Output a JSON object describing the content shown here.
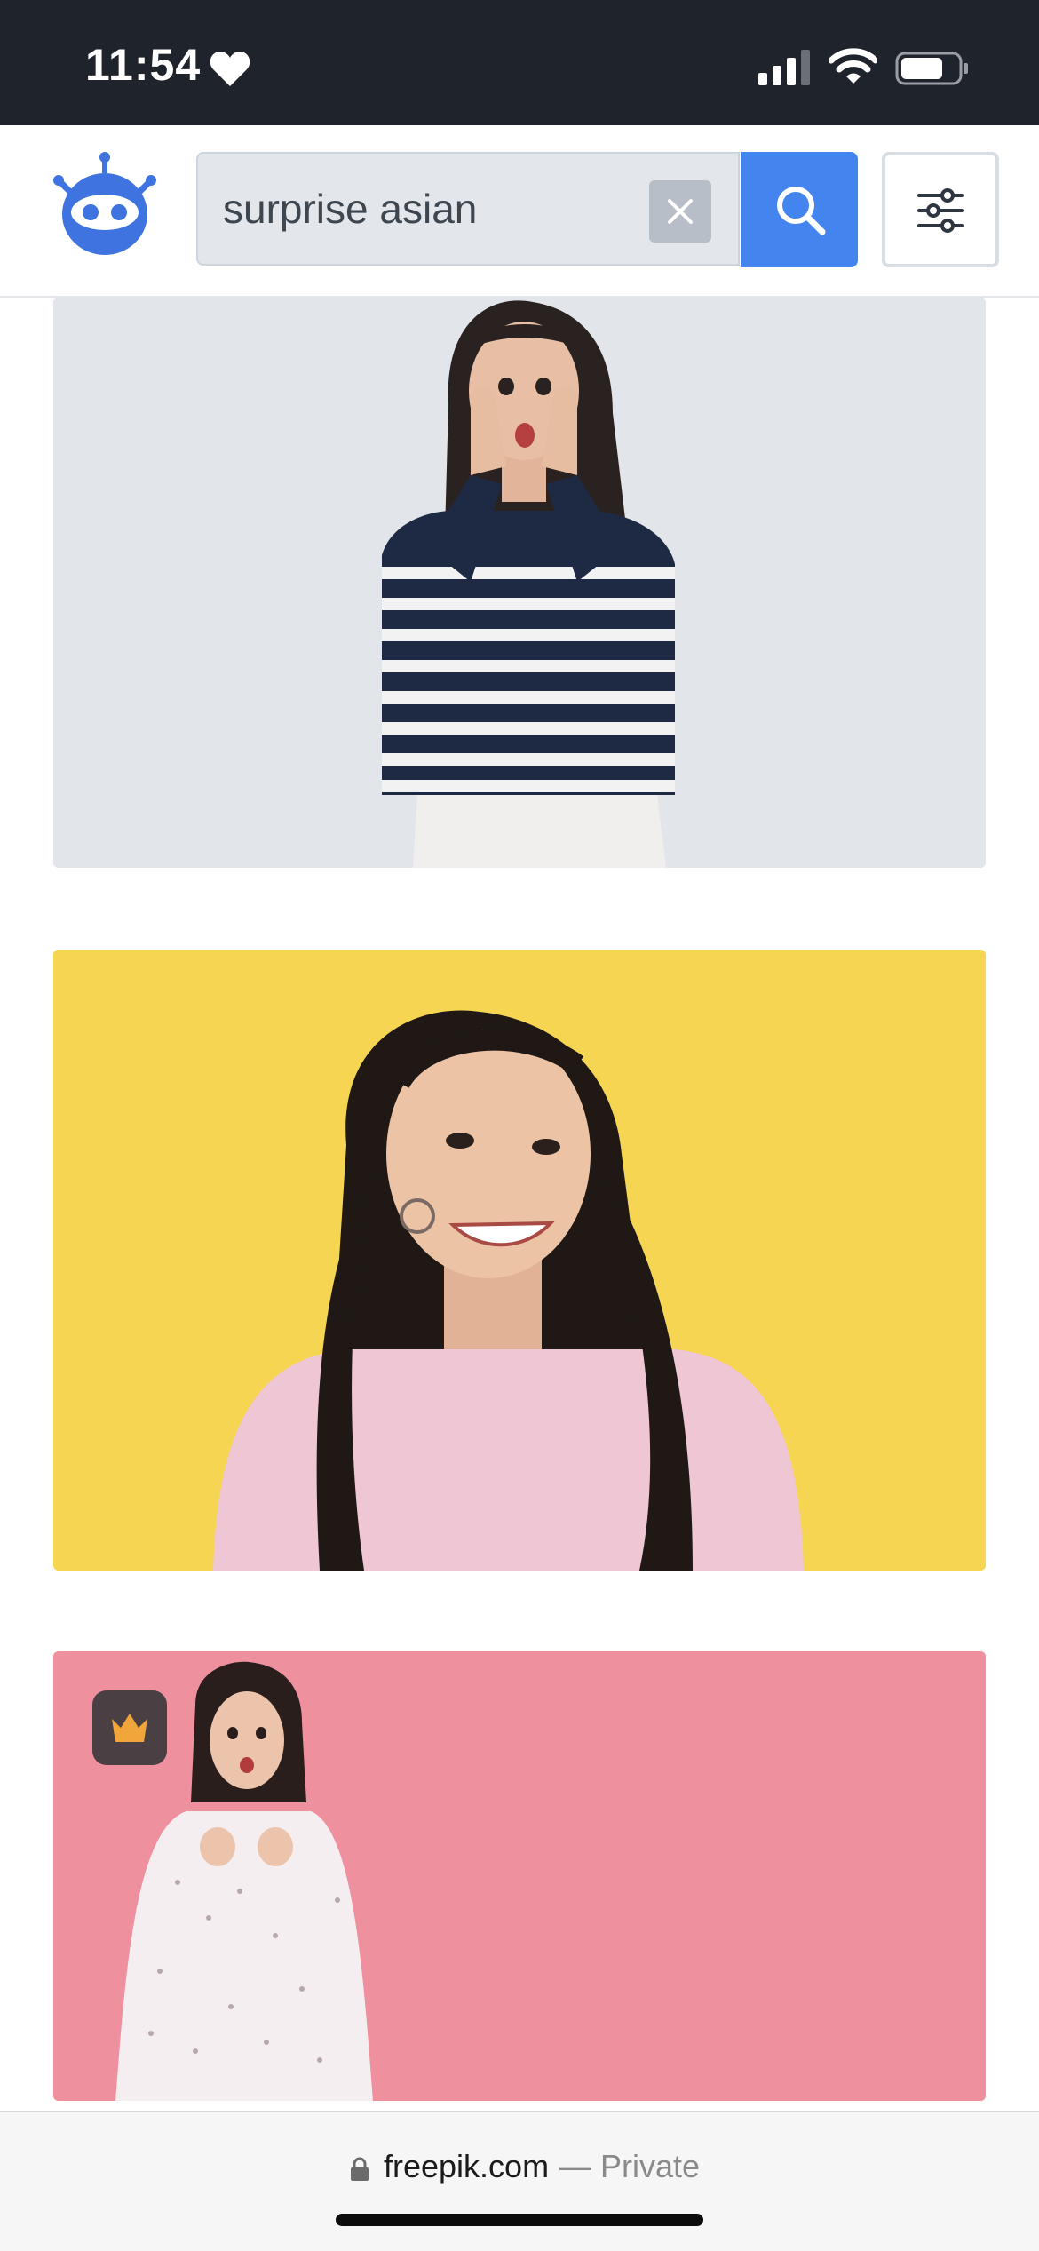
{
  "status_bar": {
    "time": "11:54",
    "icons": [
      "heart-icon",
      "signal-icon",
      "wifi-icon",
      "battery-icon"
    ]
  },
  "header": {
    "logo": "robot-logo-icon",
    "search": {
      "value": "surprise asian",
      "clear_icon": "close-icon",
      "search_icon": "search-icon"
    },
    "filter_icon": "sliders-icon",
    "accent_color": "#4484ee"
  },
  "results": [
    {
      "background": "#e2e5e9",
      "premium": false
    },
    {
      "background": "#f5d552",
      "premium": false
    },
    {
      "background": "#ee909e",
      "premium": true,
      "badge_icon": "crown-icon"
    }
  ],
  "url_bar": {
    "domain": "freepik.com",
    "private": "— Private",
    "lock_icon": "lock-icon"
  }
}
